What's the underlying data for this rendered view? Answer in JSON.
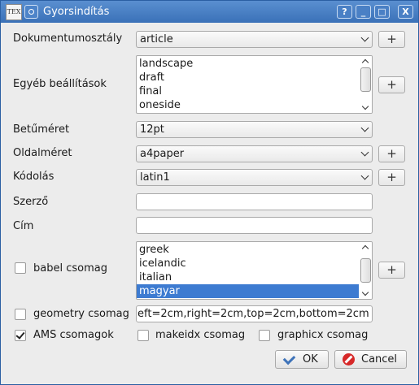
{
  "window": {
    "title": "Gyorsindítás",
    "app_icon_text": "TEX",
    "help_button": "?",
    "minimize_button": "_",
    "maximize_button": "□",
    "close_button": "X"
  },
  "form": {
    "document_class": {
      "label": "Dokumentumosztály",
      "value": "article",
      "add": "+"
    },
    "other_options": {
      "label": "Egyéb beállítások",
      "items": [
        "landscape",
        "draft",
        "final",
        "oneside"
      ],
      "add": "+"
    },
    "font_size": {
      "label": "Betűméret",
      "value": "12pt"
    },
    "paper_size": {
      "label": "Oldalméret",
      "value": "a4paper",
      "add": "+"
    },
    "encoding": {
      "label": "Kódolás",
      "value": "latin1",
      "add": "+"
    },
    "author": {
      "label": "Szerző",
      "value": ""
    },
    "title": {
      "label": "Cím",
      "value": ""
    },
    "babel": {
      "label": "babel csomag",
      "checked": false,
      "items": [
        "greek",
        "icelandic",
        "italian",
        "magyar"
      ],
      "selected": "magyar",
      "add": "+"
    },
    "geometry": {
      "label": "geometry csomag",
      "checked": false,
      "value": "eft=2cm,right=2cm,top=2cm,bottom=2cm"
    },
    "ams": {
      "label": "AMS csomagok",
      "checked": true
    },
    "makeidx": {
      "label": "makeidx csomag",
      "checked": false
    },
    "graphicx": {
      "label": "graphicx csomag",
      "checked": false
    }
  },
  "buttons": {
    "ok": "OK",
    "cancel": "Cancel"
  },
  "colors": {
    "titlebar": "#3a71b8",
    "selection": "#3d7bd1",
    "cancel_icon": "#d62828"
  }
}
